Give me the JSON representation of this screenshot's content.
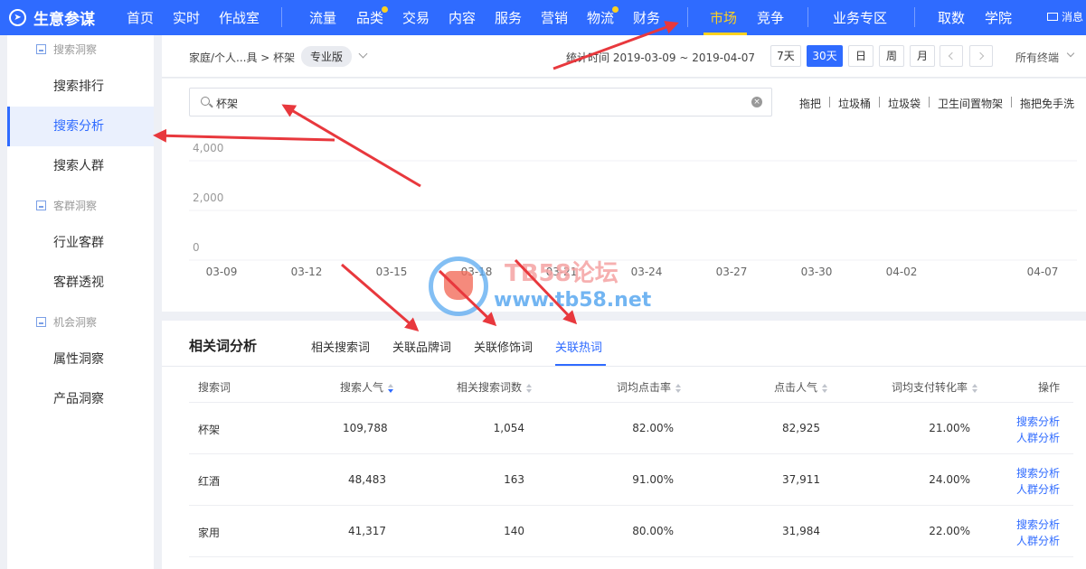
{
  "app": {
    "logo_icon": "compass-icon",
    "logo_text": "生意参谋"
  },
  "nav": {
    "items": [
      "首页",
      "实时",
      "作战室",
      "流量",
      "品类",
      "交易",
      "内容",
      "服务",
      "营销",
      "物流",
      "财务",
      "市场",
      "竞争",
      "业务专区",
      "取数",
      "学院"
    ],
    "active": "市场",
    "dot_items": [
      "品类",
      "物流"
    ],
    "message_label": "消息",
    "message_icon": "envelope-icon",
    "accent_color": "#ffd21f",
    "bar_color": "#2f6bff"
  },
  "sidebar": {
    "groups": [
      {
        "label": "搜索洞察",
        "icon": "bar-chart-icon",
        "items": [
          "搜索排行",
          "搜索分析",
          "搜索人群"
        ]
      },
      {
        "label": "客群洞察",
        "icon": "bar-chart-icon",
        "items": [
          "行业客群",
          "客群透视"
        ]
      },
      {
        "label": "机会洞察",
        "icon": "bar-chart-icon",
        "items": [
          "属性洞察",
          "产品洞察"
        ]
      }
    ],
    "active": "搜索分析"
  },
  "filter": {
    "breadcrumb": "家庭/个人...具 > 杯架",
    "edition": "专业版",
    "stat_time": "统计时间 2019-03-09 ~ 2019-04-07",
    "ranges": [
      "7天",
      "30天",
      "日",
      "周",
      "月"
    ],
    "active_range": "30天",
    "terminal": "所有终端"
  },
  "search": {
    "icon": "search-icon",
    "value": "杯架",
    "related": [
      "拖把",
      "垃圾桶",
      "垃圾袋",
      "卫生间置物架",
      "拖把免手洗"
    ]
  },
  "chart_data": {
    "type": "line",
    "y_ticks": [
      "4,000",
      "2,000",
      "0"
    ],
    "x_ticks": [
      "03-09",
      "03-12",
      "03-15",
      "03-18",
      "03-21",
      "03-24",
      "03-27",
      "03-30",
      "04-02",
      "04-07"
    ],
    "ylim": [
      0,
      4000
    ],
    "grid": true
  },
  "analysis": {
    "title": "相关词分析",
    "tabs": [
      "相关搜索词",
      "关联品牌词",
      "关联修饰词",
      "关联热词"
    ],
    "active_tab": "关联热词",
    "columns": [
      "搜索词",
      "搜索人气",
      "相关搜索词数",
      "词均点击率",
      "点击人气",
      "词均支付转化率",
      "操作"
    ],
    "rows": [
      {
        "term": "杯架",
        "popularity": "109,788",
        "related_count": "1,054",
        "ctr": "82.00%",
        "click_pop": "82,925",
        "cvr": "21.00%"
      },
      {
        "term": "红酒",
        "popularity": "48,483",
        "related_count": "163",
        "ctr": "91.00%",
        "click_pop": "37,911",
        "cvr": "24.00%"
      },
      {
        "term": "家用",
        "popularity": "41,317",
        "related_count": "140",
        "ctr": "80.00%",
        "click_pop": "31,984",
        "cvr": "22.00%"
      }
    ],
    "actions": [
      "搜索分析",
      "人群分析"
    ]
  },
  "watermark": {
    "line1": "TB58论坛",
    "line2": "www.tb58.net"
  },
  "annotation_color": "#e8383d"
}
